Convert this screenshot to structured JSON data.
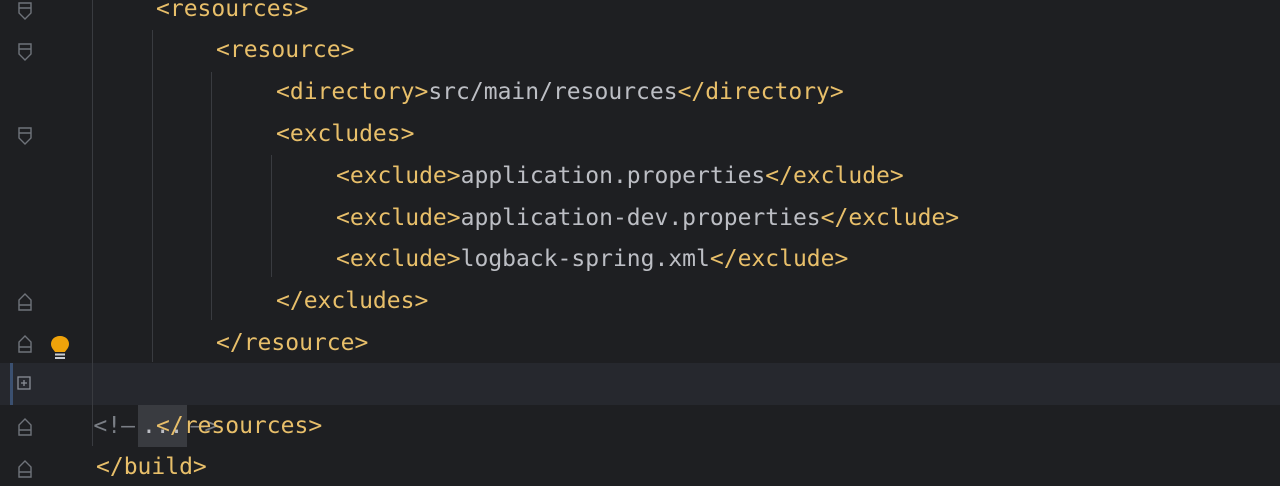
{
  "code_lines": [
    {
      "open": "<resources>"
    },
    {
      "open": "<resource>"
    },
    {
      "open": "<directory>",
      "text": "src/main/resources",
      "close": "</directory>"
    },
    {
      "open": "<excludes>"
    },
    {
      "open": "<exclude>",
      "text": "application.properties",
      "close": "</exclude>"
    },
    {
      "open": "<exclude>",
      "text": "application-dev.properties",
      "close": "</exclude>"
    },
    {
      "open": "<exclude>",
      "text": "logback-spring.xml",
      "close": "</exclude>"
    },
    {
      "open": "</excludes>"
    },
    {
      "open": "</resource>"
    },
    {
      "folded_start": "<!—",
      "folded_dots": "...",
      "folded_end": "—>"
    },
    {
      "open": "</resources>"
    },
    {
      "open": "</build>"
    }
  ],
  "colors": {
    "background": "#1e1f22",
    "tag": "#e8bf6a",
    "text": "#bcbec4",
    "current_line": "#26282e",
    "bulb": "#f0a30a"
  },
  "icons": {
    "fold": "fold-arrow-icon",
    "bulb": "lightbulb-icon",
    "expand": "expand-plus-icon"
  }
}
